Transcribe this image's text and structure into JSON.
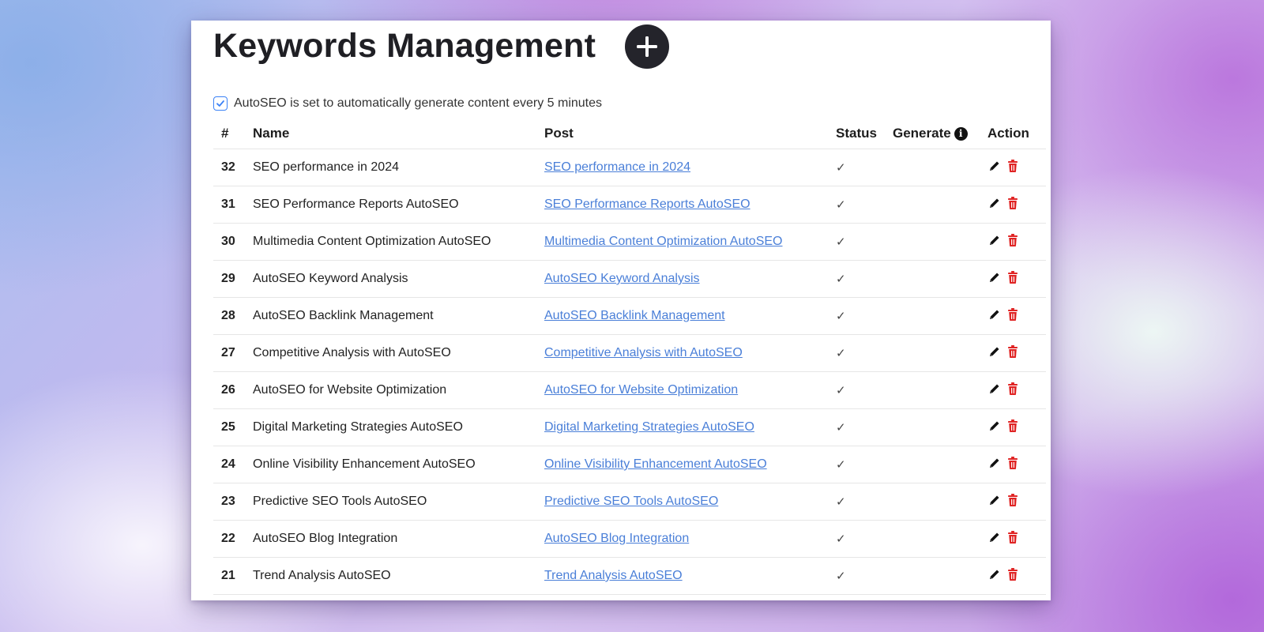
{
  "page": {
    "title": "Keywords Management",
    "add_label": "+"
  },
  "auto_setting": {
    "checked": true,
    "text": "AutoSEO is set to automatically generate content every 5 minutes"
  },
  "table": {
    "headers": {
      "num": "#",
      "name": "Name",
      "post": "Post",
      "status": "Status",
      "generate": "Generate",
      "action": "Action"
    },
    "rows": [
      {
        "id": "32",
        "name": "SEO performance in 2024",
        "post": "SEO performance in 2024",
        "status": "✓"
      },
      {
        "id": "31",
        "name": "SEO Performance Reports AutoSEO",
        "post": "SEO Performance Reports AutoSEO",
        "status": "✓"
      },
      {
        "id": "30",
        "name": "Multimedia Content Optimization AutoSEO",
        "post": "Multimedia Content Optimization AutoSEO",
        "status": "✓"
      },
      {
        "id": "29",
        "name": "AutoSEO Keyword Analysis",
        "post": "AutoSEO Keyword Analysis",
        "status": "✓"
      },
      {
        "id": "28",
        "name": "AutoSEO Backlink Management",
        "post": "AutoSEO Backlink Management",
        "status": "✓"
      },
      {
        "id": "27",
        "name": "Competitive Analysis with AutoSEO",
        "post": "Competitive Analysis with AutoSEO",
        "status": "✓"
      },
      {
        "id": "26",
        "name": "AutoSEO for Website Optimization",
        "post": "AutoSEO for Website Optimization",
        "status": "✓"
      },
      {
        "id": "25",
        "name": "Digital Marketing Strategies AutoSEO",
        "post": "Digital Marketing Strategies AutoSEO",
        "status": "✓"
      },
      {
        "id": "24",
        "name": "Online Visibility Enhancement AutoSEO",
        "post": "Online Visibility Enhancement AutoSEO",
        "status": "✓"
      },
      {
        "id": "23",
        "name": "Predictive SEO Tools AutoSEO",
        "post": "Predictive SEO Tools AutoSEO",
        "status": "✓"
      },
      {
        "id": "22",
        "name": "AutoSEO Blog Integration",
        "post": "AutoSEO Blog Integration",
        "status": "✓"
      },
      {
        "id": "21",
        "name": "Trend Analysis AutoSEO",
        "post": "Trend Analysis AutoSEO",
        "status": "✓"
      }
    ]
  },
  "icons": {
    "add": "plus-circle-icon",
    "info": "info-icon",
    "edit": "pencil-icon",
    "delete": "trash-icon"
  },
  "colors": {
    "link": "#4a7fd8",
    "delete": "#e02424",
    "add_button": "#24242b",
    "checkbox": "#3b82f6"
  }
}
